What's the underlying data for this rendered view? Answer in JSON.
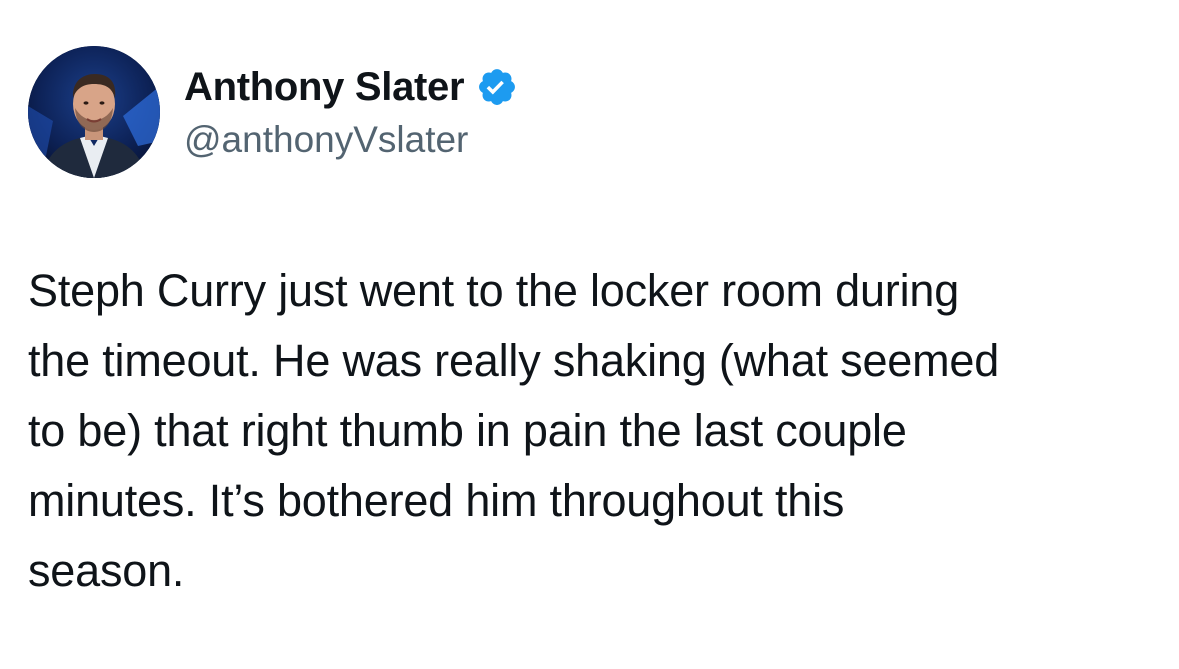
{
  "author": {
    "display_name": "Anthony Slater",
    "handle": "@anthonyVslater",
    "verified": true,
    "verified_color": "#1d9bf0"
  },
  "tweet": {
    "lines": [
      "Steph Curry just went to the locker room during",
      "the timeout. He was really shaking (what seemed",
      "to be) that right thumb in pain the last couple",
      "minutes. It’s bothered him throughout this",
      "season."
    ]
  },
  "colors": {
    "text_primary": "#0f1419",
    "text_secondary": "#536471",
    "background": "#ffffff"
  },
  "icons": {
    "verified": "verified-badge-icon",
    "avatar": "profile-photo"
  }
}
